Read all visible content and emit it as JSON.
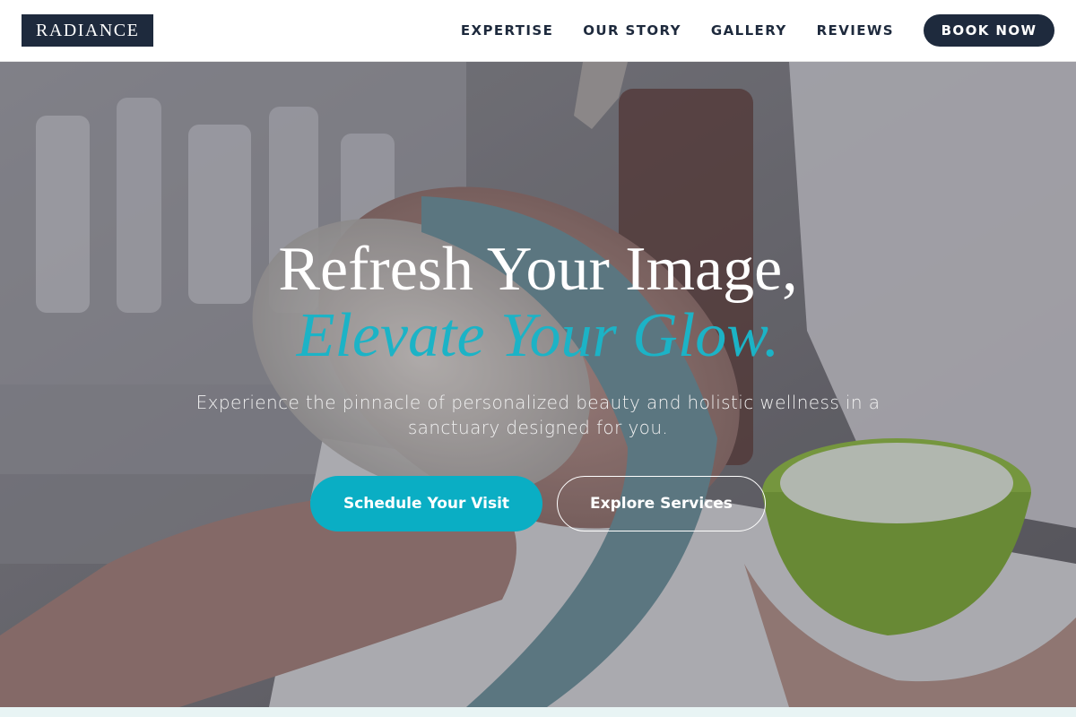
{
  "header": {
    "logo": "RADIANCE",
    "nav": [
      {
        "label": "EXPERTISE"
      },
      {
        "label": "OUR STORY"
      },
      {
        "label": "GALLERY"
      },
      {
        "label": "REVIEWS"
      }
    ],
    "cta": "BOOK NOW"
  },
  "hero": {
    "title": "Refresh Your Image,",
    "title_accent": "Elevate Your Glow.",
    "subtitle": "Experience the pinnacle of personalized beauty and holistic wellness in a sanctuary designed for you.",
    "primary_button": "Schedule Your Visit",
    "secondary_button": "Explore Services"
  },
  "colors": {
    "navy": "#1e2a3d",
    "accent": "#1cb3c6",
    "button_teal": "#0aaec4"
  }
}
